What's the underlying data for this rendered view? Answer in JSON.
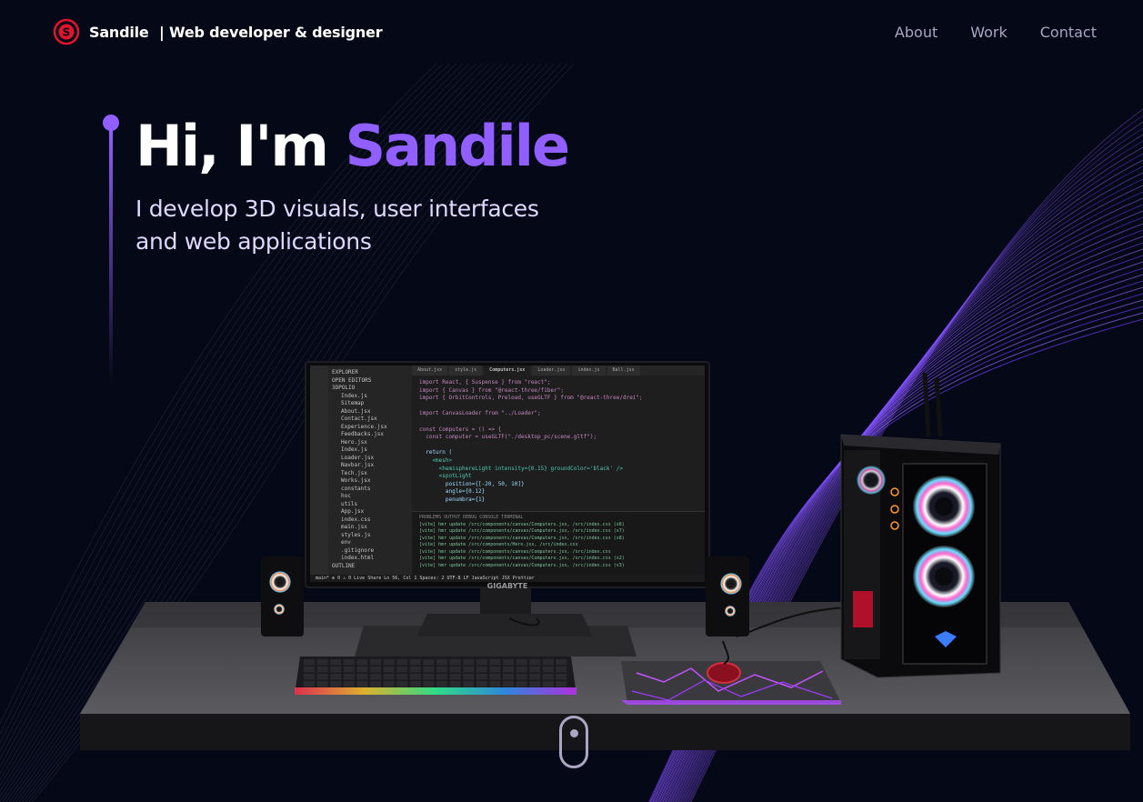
{
  "nav": {
    "brand_name": "Sandile",
    "brand_tagline": "| Web developer & designer",
    "links": [
      "About",
      "Work",
      "Contact"
    ]
  },
  "hero": {
    "greeting": "Hi, I'm ",
    "name": "Sandile",
    "subtitle": "I develop 3D visuals, user interfaces and web applications"
  },
  "monitor": {
    "brand": "GIGABYTE",
    "tabs": [
      "About.jsx",
      "style.js",
      "Computers.jsx",
      "Loader.jsx",
      "index.js",
      "Ball.jsx"
    ],
    "explorer": [
      "EXPLORER",
      "OPEN EDITORS",
      "3DPOLIO",
      "Index.js",
      "Sitemap",
      "About.jsx",
      "Contact.jsx",
      "Experience.jsx",
      "Feedbacks.jsx",
      "Hero.jsx",
      "Index.js",
      "Loader.jsx",
      "Navbar.jsx",
      "Tech.jsx",
      "Works.jsx",
      "constants",
      "hoc",
      "utils",
      "App.jsx",
      "index.css",
      "main.jsx",
      "styles.js",
      "env",
      ".gitignore",
      "index.html",
      "OUTLINE"
    ],
    "code_lines": [
      "import React, { Suspense } from \"react\";",
      "import { Canvas } from \"@react-three/fiber\";",
      "import { OrbitControls, Preload, useGLTF } from \"@react-three/drei\";",
      "",
      "import CanvasLoader from \"../Loader\";",
      "",
      "const Computers = () => {",
      "  const computer = useGLTF(\"./desktop_pc/scene.gltf\");",
      "",
      "  return (",
      "    <mesh>",
      "      <hemisphereLight intensity={0.15} groundColor='black' />",
      "      <spotLight",
      "        position={[-20, 50, 10]}",
      "        angle={0.12}",
      "        penumbra={1}"
    ],
    "terminal_tabs": [
      "PROBLEMS",
      "OUTPUT",
      "DEBUG CONSOLE",
      "TERMINAL"
    ],
    "terminal_lines": [
      "[vite] hmr update /src/components/canvas/Computers.jsx, /src/index.css (x6)",
      "[vite] hmr update /src/components/canvas/Computers.jsx, /src/index.css (x7)",
      "[vite] hmr update /src/components/canvas/Computers.jsx, /src/index.css (x8)",
      "[vite] hmr update /src/components/Hero.jsx, /src/index.css",
      "[vite] hmr update /src/components/canvas/Computers.jsx, /src/index.css",
      "[vite] hmr update /src/components/canvas/Computers.jsx, /src/index.css (x2)",
      "[vite] hmr update /src/components/canvas/Computers.jsx, /src/index.css (x3)"
    ],
    "status": "main*   ⊗ 0 ⚠ 0   Live Share        Ln 56, Col 1   Spaces: 2   UTF-8   LF   JavaScript JSX   Prettier"
  },
  "colors": {
    "background": "#050816",
    "accent": "#915eff",
    "nav_link": "#aaa6c3",
    "subtitle": "#dfd9ff"
  },
  "icons": {
    "logo": "logo-s-icon",
    "scroll": "mouse-scroll-icon"
  }
}
